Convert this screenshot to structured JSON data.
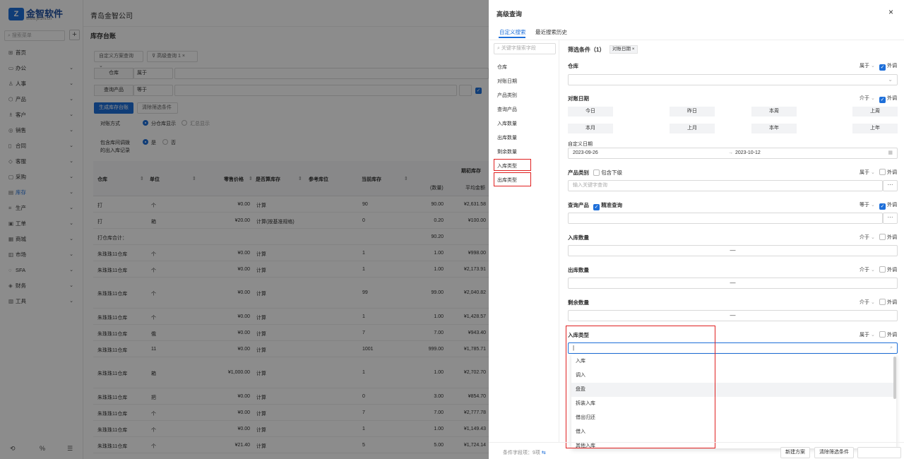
{
  "app": {
    "logo_mark": "Z",
    "logo_name": "金智软件",
    "logo_url": "www.jinzhi.cn",
    "company": "青岛金智公司"
  },
  "sidebar": {
    "search_placeholder": "搜索菜单",
    "add": "+",
    "items": [
      {
        "icon": "⊞",
        "label": "首页",
        "expand": false
      },
      {
        "icon": "▭",
        "label": "办公",
        "expand": true
      },
      {
        "icon": "♙",
        "label": "人事",
        "expand": true
      },
      {
        "icon": "⬡",
        "label": "产品",
        "expand": true
      },
      {
        "icon": "♗",
        "label": "客户",
        "expand": true
      },
      {
        "icon": "◎",
        "label": "销售",
        "expand": true
      },
      {
        "icon": "▯",
        "label": "合同",
        "expand": true
      },
      {
        "icon": "◇",
        "label": "客服",
        "expand": true
      },
      {
        "icon": "▢",
        "label": "采购",
        "expand": true
      },
      {
        "icon": "▤",
        "label": "库存",
        "expand": true,
        "active": true
      },
      {
        "icon": "⌗",
        "label": "生产",
        "expand": true
      },
      {
        "icon": "▣",
        "label": "工单",
        "expand": true
      },
      {
        "icon": "▦",
        "label": "商城",
        "expand": true
      },
      {
        "icon": "▥",
        "label": "市场",
        "expand": true
      },
      {
        "icon": "◌",
        "label": "SFA",
        "expand": true
      },
      {
        "icon": "◈",
        "label": "财务",
        "expand": true
      },
      {
        "icon": "▧",
        "label": "工具",
        "expand": true
      }
    ],
    "bottom": [
      "⟲",
      "%",
      "☰"
    ]
  },
  "page": {
    "title": "库存台账",
    "scheme_placeholder": "自定义方案查询",
    "advanced_btn": "高级查询",
    "adv_badge": "1 ×",
    "row1_label": "仓库",
    "row1_op": "属于",
    "row2_label": "查询产品",
    "row2_op": "等于",
    "gen_btn": "生成库存台账",
    "clear_btn": "清除筛选条件",
    "recon_label": "对账方式",
    "recon_opt1": "分仓库显示",
    "recon_opt2": "汇总显示",
    "include_label_1": "包含库间调拨",
    "include_label_2": "的出入库记录",
    "yes": "是",
    "no": "否"
  },
  "table": {
    "headers": {
      "warehouse": "仓库",
      "unit": "单位",
      "price": "零售价格",
      "is_calc": "是否算库存",
      "ref": "参考库位",
      "stock": "当前库存",
      "period_start": "期初库存",
      "qty": "(数量)",
      "avg": "平均金额"
    },
    "rows": [
      {
        "w": "打",
        "u": "个",
        "p": "¥0.00",
        "c": "计算",
        "s": "90",
        "q": "90.00",
        "a": "¥2,631.58",
        "tall": false
      },
      {
        "w": "打",
        "u": "箱",
        "p": "¥20.00",
        "c": "计算(按基准规格)",
        "s": "0",
        "q": "0.20",
        "a": "¥100.00",
        "tall": false
      },
      {
        "w": "打仓库合计：",
        "u": "",
        "p": "",
        "c": "",
        "s": "",
        "q": "90.20",
        "a": "",
        "tall": false
      },
      {
        "w": "朱珠珠11仓库",
        "u": "个",
        "p": "¥0.00",
        "c": "计算",
        "s": "1",
        "q": "1.00",
        "a": "¥998.00",
        "tall": false
      },
      {
        "w": "朱珠珠11仓库",
        "u": "个",
        "p": "¥0.00",
        "c": "计算",
        "s": "1",
        "q": "1.00",
        "a": "¥2,173.91",
        "tall": false
      },
      {
        "w": "朱珠珠11仓库",
        "u": "个",
        "p": "¥0.00",
        "c": "计算",
        "s": "99",
        "q": "99.00",
        "a": "¥2,040.82",
        "tall": true
      },
      {
        "w": "朱珠珠11仓库",
        "u": "个",
        "p": "¥0.00",
        "c": "计算",
        "s": "1",
        "q": "1.00",
        "a": "¥1,428.57",
        "tall": false
      },
      {
        "w": "朱珠珠11仓库",
        "u": "俄",
        "p": "¥0.00",
        "c": "计算",
        "s": "7",
        "q": "7.00",
        "a": "¥943.40",
        "tall": false
      },
      {
        "w": "朱珠珠11仓库",
        "u": "11",
        "p": "¥0.00",
        "c": "计算",
        "s": "1001",
        "q": "999.00",
        "a": "¥1,785.71",
        "tall": false
      },
      {
        "w": "朱珠珠11仓库",
        "u": "箱",
        "p": "¥1,000.00",
        "c": "计算",
        "s": "1",
        "q": "1.00",
        "a": "¥2,702.70",
        "tall": true
      },
      {
        "w": "朱珠珠11仓库",
        "u": "把",
        "p": "¥0.00",
        "c": "计算",
        "s": "0",
        "q": "3.00",
        "a": "¥854.70",
        "tall": false
      },
      {
        "w": "朱珠珠11仓库",
        "u": "个",
        "p": "¥0.00",
        "c": "计算",
        "s": "7",
        "q": "7.00",
        "a": "¥2,777.78",
        "tall": false
      },
      {
        "w": "朱珠珠11仓库",
        "u": "个",
        "p": "¥0.00",
        "c": "计算",
        "s": "1",
        "q": "1.00",
        "a": "¥1,149.43",
        "tall": false
      },
      {
        "w": "朱珠珠11仓库",
        "u": "个",
        "p": "¥21.40",
        "c": "计算",
        "s": "5",
        "q": "5.00",
        "a": "¥1,724.14",
        "tall": false
      }
    ]
  },
  "drawer": {
    "title": "高级查询",
    "close": "×",
    "tab1": "自定义搜索",
    "tab2": "最近搜索历史",
    "field_search_placeholder": "关键字搜索字段",
    "fields": [
      "仓库",
      "对账日期",
      "产品类别",
      "查询产品",
      "入库数量",
      "出库数量",
      "剩余数量",
      "入库类型",
      "出库类型"
    ],
    "cond_title": "筛选条件（1）",
    "cond_tag": "对账日期 ×",
    "warehouse": {
      "label": "仓库",
      "op": "属于",
      "outer": "外调"
    },
    "date": {
      "label": "对账日期",
      "op": "介于",
      "outer": "外调",
      "quick": [
        "今日",
        "昨日",
        "本周",
        "上周",
        "本月",
        "上月",
        "本年",
        "上年"
      ],
      "custom_label": "自定义日期",
      "start": "2023-09-26",
      "sep": "→",
      "end": "2023-10-12"
    },
    "category": {
      "label": "产品类别",
      "include": "包含下级",
      "op": "属于",
      "outer": "外调",
      "placeholder": "输入关键字查询",
      "more": "···"
    },
    "product": {
      "label": "查询产品",
      "exact": "精准查询",
      "op": "等于",
      "outer": "外调",
      "more": "···"
    },
    "in_qty": {
      "label": "入库数量",
      "op": "介于",
      "outer": "外调",
      "dash": "—"
    },
    "out_qty": {
      "label": "出库数量",
      "op": "介于",
      "outer": "外调",
      "dash": "—"
    },
    "left_qty": {
      "label": "剩余数量",
      "op": "介于",
      "outer": "外调",
      "dash": "—"
    },
    "in_type": {
      "label": "入库类型",
      "op": "属于",
      "outer": "外调",
      "cursor": "|"
    },
    "options": [
      "入库",
      "调入",
      "盘盈",
      "拆装入库",
      "借出归还",
      "借入",
      "其他入库"
    ],
    "hover_option": 2,
    "footer_count": "条件字段项：9项",
    "new_scheme": "新建方案",
    "clear": "清除筛选条件",
    "generate": "生成库存台账"
  },
  "colors": {
    "primary": "#1e6fd9",
    "highlight": "#e02020"
  }
}
